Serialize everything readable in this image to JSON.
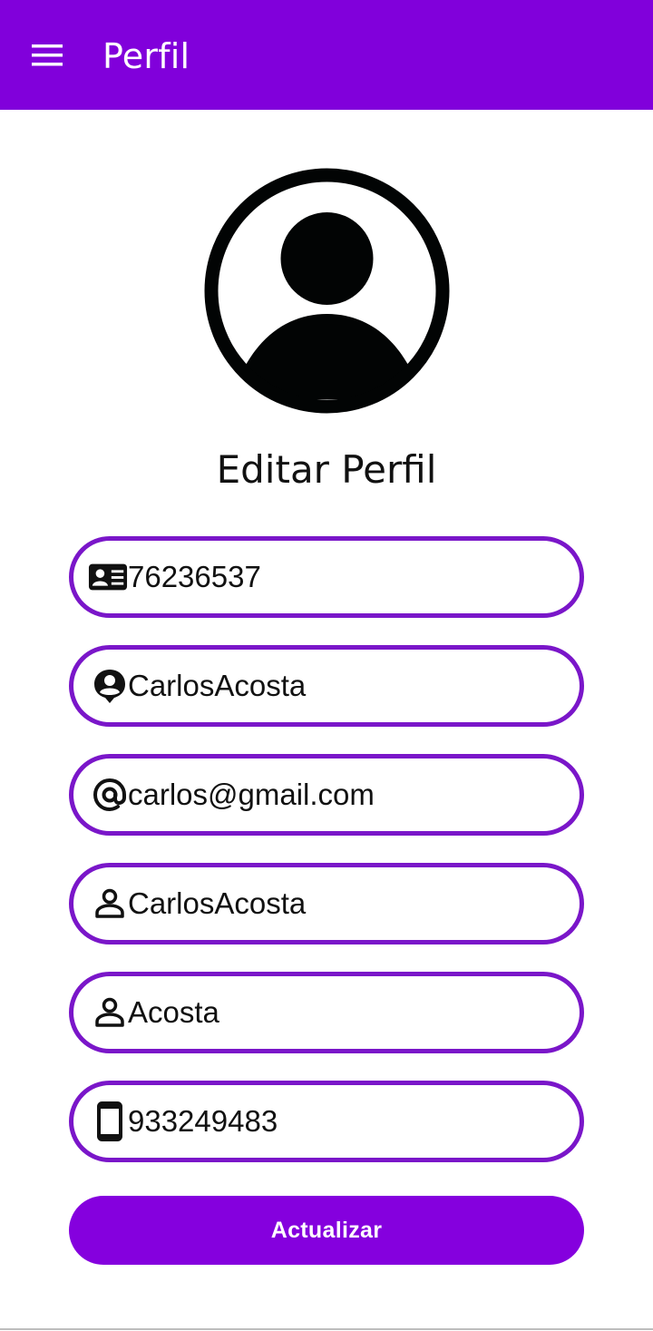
{
  "appbar": {
    "title": "Perfil",
    "menu_icon": "hamburger-menu-icon",
    "color": "#8100db"
  },
  "avatar_icon": "account-circle-icon",
  "heading": "Editar Perfil",
  "form": {
    "fields": [
      {
        "name": "dni",
        "icon": "id-card-icon",
        "value": "76236537"
      },
      {
        "name": "username",
        "icon": "account-pin-icon",
        "value": "CarlosAcosta"
      },
      {
        "name": "email",
        "icon": "at-sign-icon",
        "value": "carlos@gmail.com"
      },
      {
        "name": "first-name",
        "icon": "person-outline-icon",
        "value": "CarlosAcosta"
      },
      {
        "name": "last-name",
        "icon": "person-outline-icon",
        "value": "Acosta"
      },
      {
        "name": "phone",
        "icon": "smartphone-icon",
        "value": "933249483"
      }
    ],
    "border_color": "#7a16c9"
  },
  "actions": {
    "update_label": "Actualizar",
    "button_color": "#8500de"
  }
}
